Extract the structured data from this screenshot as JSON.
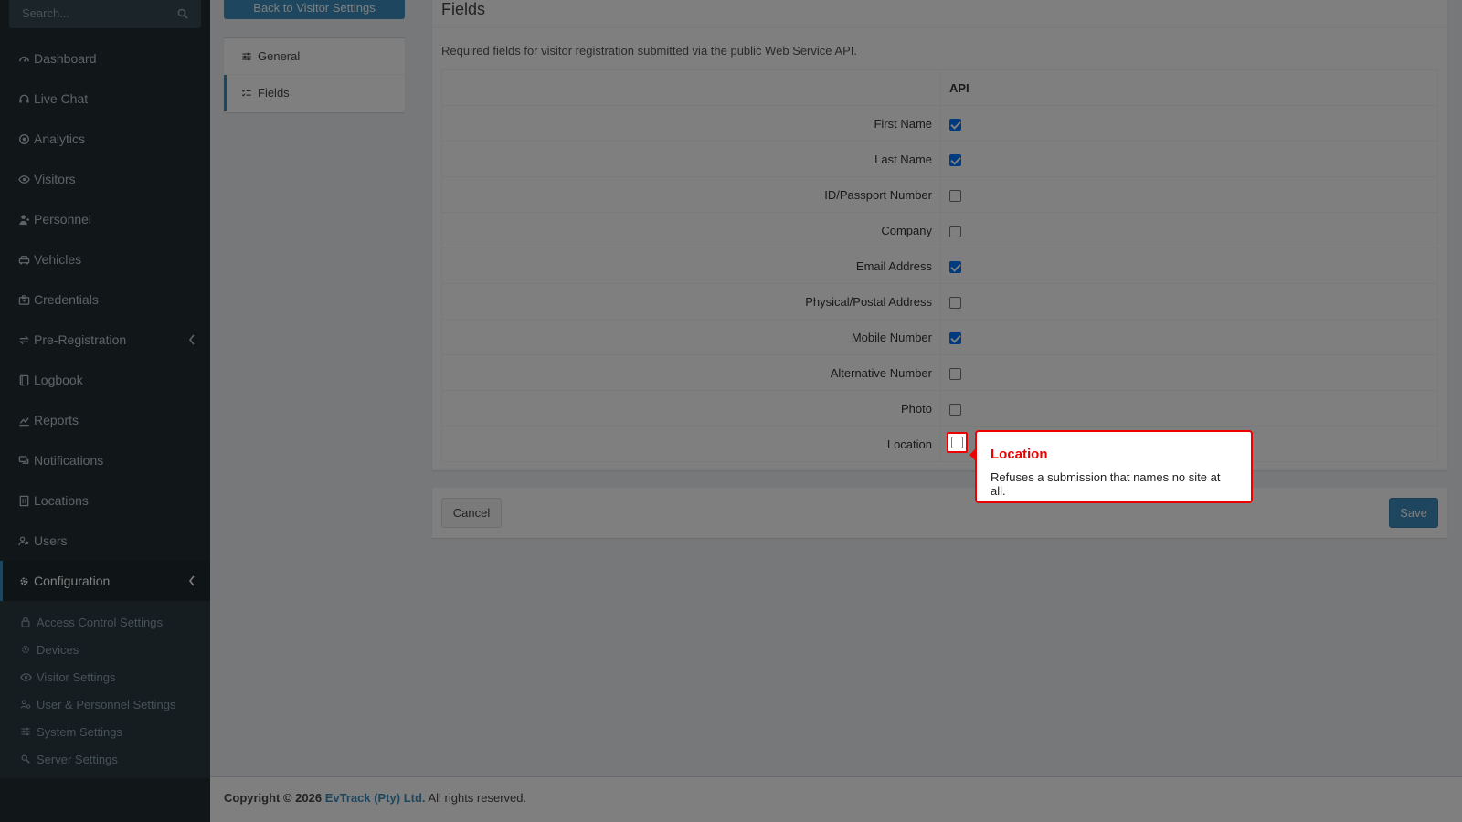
{
  "sidebar": {
    "search_placeholder": "Search...",
    "items": [
      {
        "label": "Dashboard",
        "icon": "dashboard-icon"
      },
      {
        "label": "Live Chat",
        "icon": "headset-icon"
      },
      {
        "label": "Analytics",
        "icon": "target-icon"
      },
      {
        "label": "Visitors",
        "icon": "eye-icon"
      },
      {
        "label": "Personnel",
        "icon": "user-tie-icon"
      },
      {
        "label": "Vehicles",
        "icon": "car-icon"
      },
      {
        "label": "Credentials",
        "icon": "id-card-icon"
      },
      {
        "label": "Pre-Registration",
        "icon": "exchange-icon",
        "expandable": true
      },
      {
        "label": "Logbook",
        "icon": "book-icon"
      },
      {
        "label": "Reports",
        "icon": "chart-icon"
      },
      {
        "label": "Notifications",
        "icon": "comments-icon"
      },
      {
        "label": "Locations",
        "icon": "building-icon"
      },
      {
        "label": "Users",
        "icon": "users-icon"
      },
      {
        "label": "Configuration",
        "icon": "gear-icon",
        "expandable": true,
        "active": true
      }
    ],
    "submenu": [
      {
        "label": "Access Control Settings",
        "icon": "lock-icon"
      },
      {
        "label": "Devices",
        "icon": "device-icon"
      },
      {
        "label": "Visitor Settings",
        "icon": "eye-icon"
      },
      {
        "label": "User & Personnel Settings",
        "icon": "users-cog-icon"
      },
      {
        "label": "System Settings",
        "icon": "sliders-icon"
      },
      {
        "label": "Server Settings",
        "icon": "server-icon"
      }
    ]
  },
  "content": {
    "back_button": "Back to Visitor Settings",
    "nav": [
      {
        "label": "General",
        "icon": "sliders-icon"
      },
      {
        "label": "Fields",
        "icon": "tasks-icon",
        "active": true
      }
    ],
    "fields": {
      "title": "Fields",
      "description": "Required fields for visitor registration submitted via the public Web Service API.",
      "column_header": "API",
      "rows": [
        {
          "label": "First Name",
          "checked": true
        },
        {
          "label": "Last Name",
          "checked": true
        },
        {
          "label": "ID/Passport Number",
          "checked": false
        },
        {
          "label": "Company",
          "checked": false
        },
        {
          "label": "Email Address",
          "checked": true
        },
        {
          "label": "Physical/Postal Address",
          "checked": false
        },
        {
          "label": "Mobile Number",
          "checked": true
        },
        {
          "label": "Alternative Number",
          "checked": false
        },
        {
          "label": "Photo",
          "checked": false
        },
        {
          "label": "Location",
          "checked": false
        }
      ]
    },
    "actions": {
      "cancel": "Cancel",
      "save": "Save"
    }
  },
  "footer": {
    "copyright": "Copyright © 2026",
    "brand": "EvTrack (Pty) Ltd.",
    "rights": "All rights reserved."
  },
  "tooltip": {
    "title": "Location",
    "body": "Refuses a submission that names no site at all."
  },
  "colors": {
    "accent": "#3c8dbc",
    "sidebar_bg": "#222d32",
    "highlight": "#ee0000"
  }
}
